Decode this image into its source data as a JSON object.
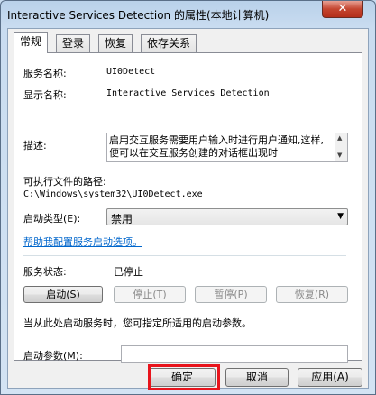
{
  "window": {
    "title": "Interactive Services Detection 的属性(本地计算机)",
    "close_symbol": "✕"
  },
  "tabs": [
    {
      "label": "常规"
    },
    {
      "label": "登录"
    },
    {
      "label": "恢复"
    },
    {
      "label": "依存关系"
    }
  ],
  "general": {
    "service_name_label": "服务名称:",
    "service_name_value": "UI0Detect",
    "display_name_label": "显示名称:",
    "display_name_value": "Interactive Services Detection",
    "description_label": "描述:",
    "description_value": "启用交互服务需要用户输入时进行用户通知,这样,便可以在交互服务创建的对话框出现时",
    "exe_path_label": "可执行文件的路径:",
    "exe_path_value": "C:\\Windows\\system32\\UI0Detect.exe",
    "startup_type_label": "启动类型(E):",
    "startup_type_value": "禁用",
    "help_link": "帮助我配置服务启动选项。",
    "status_label": "服务状态:",
    "status_value": "已停止",
    "buttons": {
      "start": "启动(S)",
      "stop": "停止(T)",
      "pause": "暂停(P)",
      "resume": "恢复(R)"
    },
    "hint": "当从此处启动服务时，您可指定所适用的启动参数。",
    "start_params_label": "启动参数(M):",
    "start_params_value": ""
  },
  "footer": {
    "ok": "确定",
    "cancel": "取消",
    "apply": "应用(A)"
  },
  "colors": {
    "highlight": "#e8141c",
    "link": "#0066cc"
  }
}
